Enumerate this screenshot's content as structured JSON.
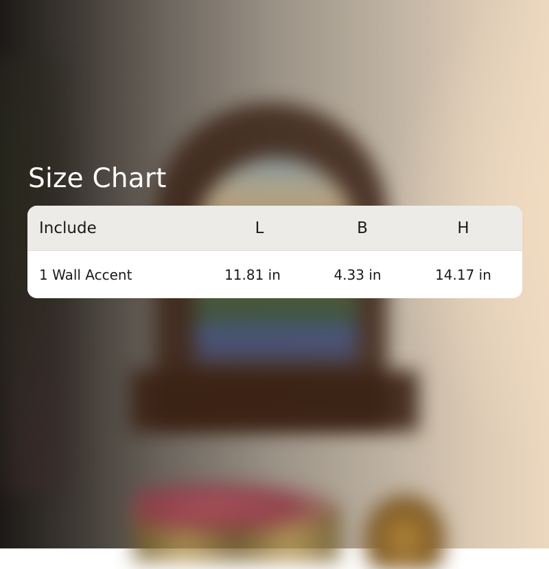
{
  "title": "Size Chart",
  "table": {
    "headers": [
      "Include",
      "L",
      "B",
      "H"
    ],
    "rows": [
      [
        "1 Wall Accent",
        "11.81 in",
        "4.33 in",
        "14.17 in"
      ]
    ]
  }
}
